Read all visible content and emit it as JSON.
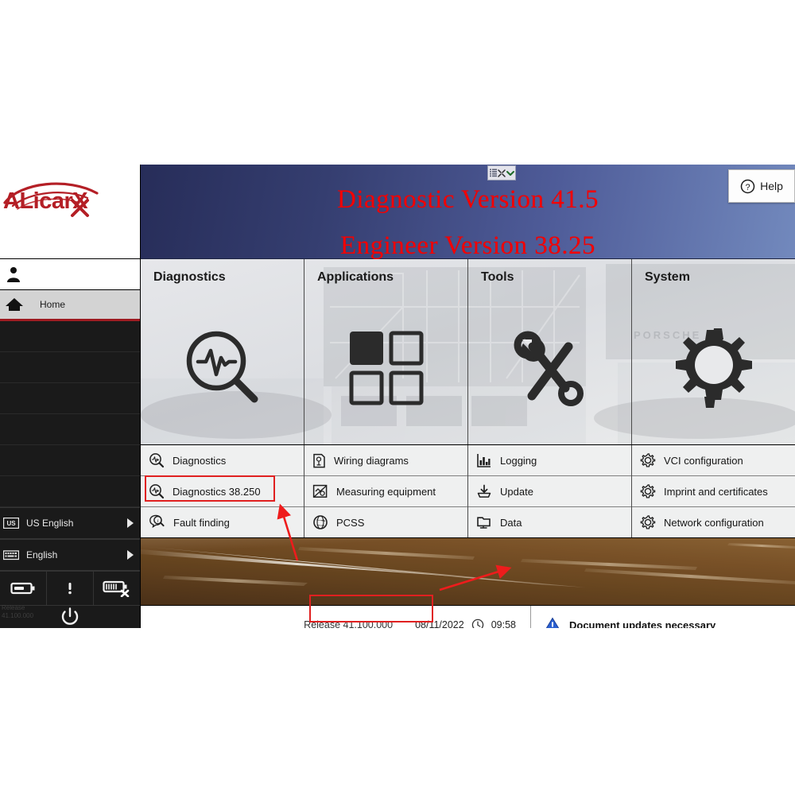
{
  "app": {
    "banner": {
      "line1": "Diagnostic Version 41.5",
      "line2": "Engineer Version 38.25",
      "help_label": "Help"
    }
  },
  "sidebar": {
    "logo_text": "ALicarX",
    "home_label": "Home",
    "language_region": "US English",
    "language_keyboard": "English",
    "release_text": "Release\n41.100.000",
    "icons": {
      "user": "person-icon",
      "home": "home-icon",
      "region": "us-flag-icon",
      "keyboard": "keyboard-icon",
      "battery": "battery-icon",
      "info": "info-icon",
      "battery_disconnected": "battery-x-icon",
      "power": "power-icon"
    }
  },
  "panels": [
    {
      "title": "Diagnostics",
      "icon": "magnifier-pulse-icon",
      "items": [
        {
          "label": "Diagnostics",
          "icon": "magnifier-pulse-icon",
          "highlighted": false
        },
        {
          "label": "Diagnostics 38.250",
          "icon": "magnifier-pulse-icon",
          "highlighted": true
        },
        {
          "label": "Fault finding",
          "icon": "fault-finding-icon",
          "highlighted": false
        }
      ]
    },
    {
      "title": "Applications",
      "icon": "four-squares-icon",
      "items": [
        {
          "label": "Wiring diagrams",
          "icon": "wiring-diagram-icon",
          "highlighted": false
        },
        {
          "label": "Measuring equipment",
          "icon": "measuring-equipment-icon",
          "highlighted": false
        },
        {
          "label": "PCSS",
          "icon": "globe-icon",
          "highlighted": false
        }
      ]
    },
    {
      "title": "Tools",
      "icon": "wrench-screwdriver-icon",
      "items": [
        {
          "label": "Logging",
          "icon": "bar-chart-icon",
          "highlighted": false
        },
        {
          "label": "Update",
          "icon": "download-icon",
          "highlighted": false
        },
        {
          "label": "Data",
          "icon": "folder-monitor-icon",
          "highlighted": false
        }
      ]
    },
    {
      "title": "System",
      "icon": "gear-icon",
      "items": [
        {
          "label": "VCI configuration",
          "icon": "gear-icon",
          "highlighted": false
        },
        {
          "label": "Imprint and certificates",
          "icon": "gear-icon",
          "highlighted": false
        },
        {
          "label": "Network configuration",
          "icon": "gear-icon",
          "highlighted": false
        }
      ]
    }
  ],
  "status": {
    "release": "Release 41.100.000",
    "date": "08/11/2022",
    "time": "09:58",
    "clock_icon": "clock-icon",
    "warning_icon": "warning-triangle-icon",
    "message": "Document updates necessary"
  },
  "watermark": {
    "text": "PORSCHE"
  },
  "colors": {
    "accent_red": "#e02020",
    "banner_text": "#f40000",
    "brand_red": "#b41f26",
    "banner_dark": "#272d59",
    "banner_light": "#7289bd",
    "warning_blue": "#2a5fd0"
  }
}
